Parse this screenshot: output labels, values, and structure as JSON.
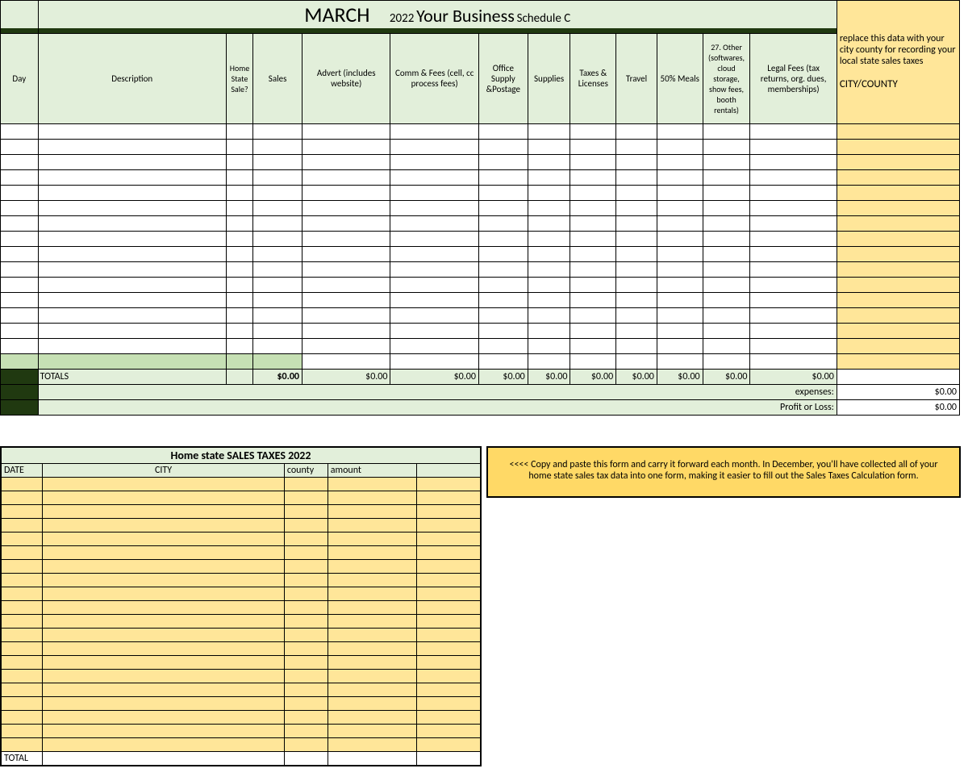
{
  "header": {
    "month": "MARCH",
    "year": "2022",
    "business": "Your Business",
    "schedule": "Schedule C"
  },
  "columns": {
    "day": "Day",
    "description": "Description",
    "home_state_sale": "Home State Sale?",
    "sales": "Sales",
    "advert": "Advert (includes website)",
    "comm_fees": "Comm & Fees (cell, cc process fees)",
    "office": "Office Supply &Postage",
    "supplies": "Supplies",
    "taxes_licenses": "Taxes & Licenses",
    "travel": "Travel",
    "meals": "50% Meals",
    "other": "27. Other (softwares, cloud storage, show fees, booth rentals)",
    "legal": "Legal Fees (tax returns, org. dues, memberships)"
  },
  "note": {
    "line": "replace this data with your city county for recording your local state sales taxes",
    "city_county": "CITY/COUNTY"
  },
  "totals": {
    "label": "TOTALS",
    "sales": "$0.00",
    "advert": "$0.00",
    "comm_fees": "$0.00",
    "office": "$0.00",
    "supplies": "$0.00",
    "taxes_licenses": "$0.00",
    "travel": "$0.00",
    "meals": "$0.00",
    "other": "$0.00",
    "legal": "$0.00"
  },
  "summary": {
    "expenses_label": "expenses:",
    "expenses_value": "$0.00",
    "profit_loss_label": "Profit or Loss:",
    "profit_loss_value": "$0.00"
  },
  "sales_tax": {
    "title": "Home state SALES TAXES 2022",
    "headers": {
      "date": "DATE",
      "city": "CITY",
      "county": "county",
      "amount": "amount"
    },
    "total_label": "TOTAL"
  },
  "tip": "<<<<    Copy and paste this form and carry it forward each month. In December, you'll have collected all of your home state sales tax data into one form, making it easier to fill out the Sales Taxes Calculation form."
}
